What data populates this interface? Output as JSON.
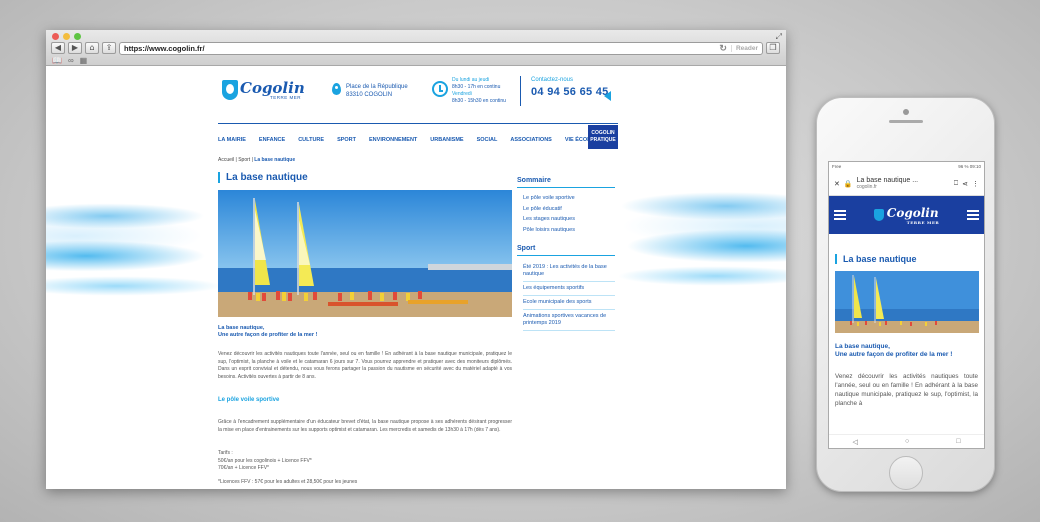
{
  "browser": {
    "url": "https://www.cogolin.fr/",
    "reader_label": "Reader"
  },
  "site": {
    "logo_text": "Cogolin",
    "logo_sub": "TERRE MER",
    "address": {
      "line1": "Place de la République",
      "line2": "83310 COGOLIN"
    },
    "hours": {
      "l1": "Du lundi au jeudi",
      "l2": "8h30 - 17h en continu",
      "l3": "Vendredi",
      "l4": "8h30 - 15h30 en continu"
    },
    "contact": {
      "label": "Contactez-nous",
      "phone": "04 94 56 65 45"
    },
    "menu": [
      "LA MAIRIE",
      "ENFANCE",
      "CULTURE",
      "SPORT",
      "ENVIRONNEMENT",
      "URBANISME",
      "SOCIAL",
      "ASSOCIATIONS",
      "VIE ÉCONOMIQUE"
    ],
    "menu_highlight": {
      "l1": "COGOLIN",
      "l2": "PRATIQUE"
    },
    "breadcrumb": {
      "home": "Accueil",
      "sport": "Sport",
      "current": "La base nautique",
      "sep": "|"
    },
    "page_title": "La base nautique",
    "intro": {
      "l1": "La base nautique,",
      "l2": "Une autre façon de profiter de la mer !"
    },
    "para1": "Venez découvrir les activités nautiques toute l'année, seul ou en famille ! En adhérant à la base nautique municipale, pratiquez le sup, l'optimist, la planche à voile et le catamaran 6 jours sur 7. Vous pourrez apprendre et pratiquer avec des moniteurs diplômés. Dans un esprit convivial et détendu, nous vous ferons partager la passion du nautisme en sécurité avec du matériel adapté à vos besoins. Activités ouvertes à partir de 8 ans.",
    "subtitle": "Le pôle voile sportive",
    "para2": "Grâce à l'encadrement supplémentaire d'un éducateur brevet d'état, la base nautique propose à ses adhérents désirant progresser la mise en place d'entrainements sur les supports optimist et catamaran. Les mercredis et samedis de 13h30 à 17h (dès 7 ans).",
    "tarifs": {
      "label": "Tarifs :",
      "t1": "50€/an pour les cogolinois + Licence FFV*",
      "t2": "70€/an + Licence FFV*",
      "note": "*Licences FFV : 57€ pour les adultes et 28,50€ pour les jeunes"
    },
    "sommaire": {
      "title": "Sommaire",
      "items": [
        "Le pôle voile sportive",
        "Le pôle éducatif",
        "Les stages nautiques",
        "Pôle loisirs nautiques"
      ]
    },
    "sport": {
      "title": "Sport",
      "items": [
        "Été 2019 : Les activités de la base nautique",
        "Les équipements sportifs",
        "Ecole municipale des sports",
        "Animations sportives vacances de printemps 2019"
      ]
    }
  },
  "phone": {
    "status_left": "Free",
    "status_right": "96 % 09:10",
    "tab_title": "La base nautique ...",
    "tab_domain": "cogolin.fr",
    "logo_text": "Cogolin",
    "logo_sub": "TERRE MER",
    "page_title": "La base nautique",
    "intro": {
      "l1": "La base nautique,",
      "l2": "Une autre façon de profiter de la mer !"
    },
    "para": "Venez découvrir les activités nautiques toute l'année, seul ou en famille ! En adhérant à la base nautique municipale, pratiquez le sup, l'optimist, la planche à"
  },
  "colors": {
    "brand_blue": "#1a5ab0",
    "accent_cyan": "#1aa3e0",
    "nav_dark": "#1a3fa0"
  }
}
